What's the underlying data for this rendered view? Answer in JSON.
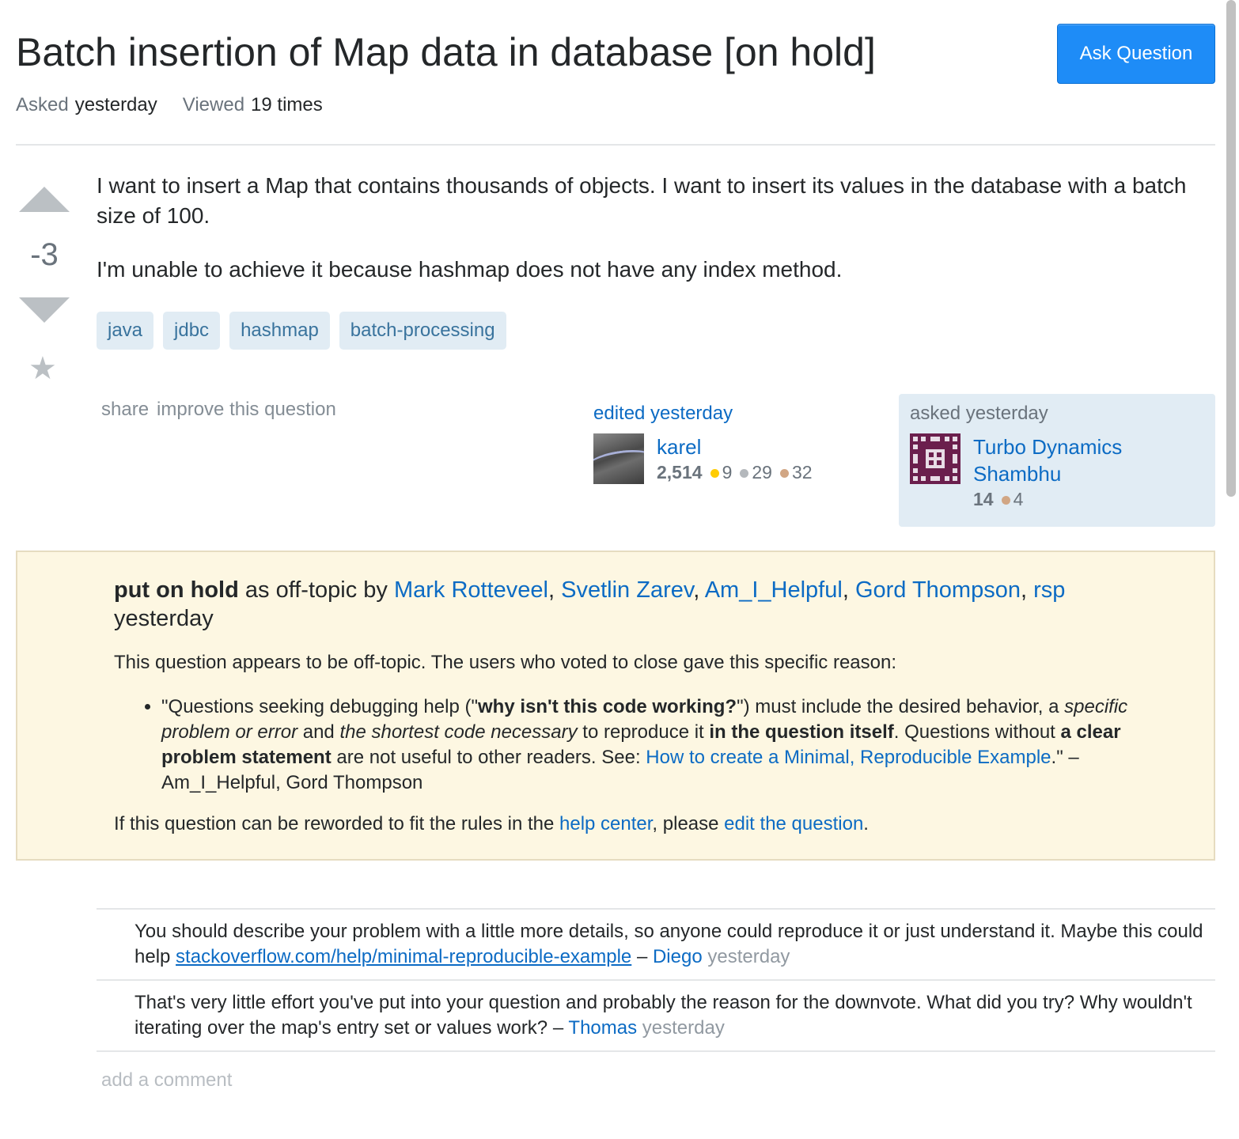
{
  "question": {
    "title": "Batch insertion of Map data in database [on hold]",
    "ask_button": "Ask Question",
    "meta": {
      "asked_label": "Asked",
      "asked_value": "yesterday",
      "viewed_label": "Viewed",
      "viewed_value": "19 times"
    },
    "votes": "-3",
    "body": [
      "I want to insert a Map that contains thousands of objects. I want to insert its values in the database with a batch size of 100.",
      "I'm unable to achieve it because hashmap does not have any index method."
    ],
    "tags": [
      "java",
      "jdbc",
      "hashmap",
      "batch-processing"
    ],
    "menu": {
      "share": "share",
      "improve": "improve this question"
    }
  },
  "edited": {
    "label": "edited yesterday",
    "user": "karel",
    "rep": "2,514",
    "gold": "9",
    "silver": "29",
    "bronze": "32"
  },
  "asked": {
    "label": "asked yesterday",
    "user": "Turbo Dynamics Shambhu",
    "rep": "14",
    "bronze": "4"
  },
  "hold": {
    "status": "put on hold",
    "as_text": "as off-topic by",
    "voters": [
      "Mark Rotteveel",
      "Svetlin Zarev",
      "Am_I_Helpful",
      "Gord Thompson",
      "rsp"
    ],
    "when": "yesterday",
    "reason_intro": "This question appears to be off-topic. The users who voted to close gave this specific reason:",
    "reason": {
      "p1": "\"Questions seeking debugging help (\"",
      "b1": "why isn't this code working?",
      "p2": "\") must include the desired behavior, a ",
      "i1": "specific problem or error",
      "p3": " and ",
      "i2": "the shortest code necessary",
      "p4": " to reproduce it ",
      "b2": "in the question itself",
      "p5": ". Questions without ",
      "b3": "a clear problem statement",
      "p6": " are not useful to other readers. See: ",
      "link": "How to create a Minimal, Reproducible Example",
      "p7": ".\" – Am_I_Helpful, Gord Thompson"
    },
    "help": {
      "p1": "If this question can be reworded to fit the rules in the ",
      "link1": "help center",
      "p2": ", please ",
      "link2": "edit the question",
      "p3": "."
    }
  },
  "comments": [
    {
      "text": "You should describe your problem with a little more details, so anyone could reproduce it or just understand it. Maybe this could help ",
      "link": "stackoverflow.com/help/minimal-reproducible-example",
      "sep": " – ",
      "user": "Diego",
      "when": "yesterday"
    },
    {
      "text": "That's very little effort you've put into your question and probably the reason for the downvote. What did you try? Why wouldn't iterating over the map's entry set or values work?",
      "sep": " – ",
      "user": "Thomas",
      "when": "yesterday"
    }
  ],
  "add_comment": "add a comment",
  "icons": {
    "upvote": "triangle-up-icon",
    "downvote": "triangle-down-icon",
    "favorite": "star-icon"
  },
  "colors": {
    "link": "#0c6bc4",
    "button": "#1e8cf7",
    "tag_bg": "#e1ecf4",
    "tag_text": "#39739d",
    "notice_bg": "#fdf7e2"
  }
}
